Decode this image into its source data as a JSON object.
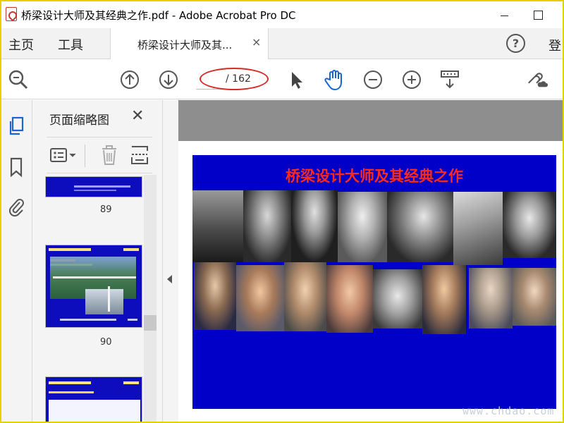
{
  "window": {
    "title": "桥梁设计大师及其经典之作.pdf - Adobe Acrobat Pro DC"
  },
  "tabs": {
    "home": "主页",
    "tools": "工具",
    "document": "桥梁设计大师及其...",
    "close": "×",
    "help": "?",
    "login": "登"
  },
  "toolbar": {
    "current_page": "",
    "page_total": "/ 162"
  },
  "thumbnails": {
    "title": "页面缩略图",
    "close": "✕",
    "pages": [
      {
        "label": "89"
      },
      {
        "label": "90"
      }
    ]
  },
  "page": {
    "title": "桥梁设计大师及其经典之作"
  },
  "watermark": "www.chdao.com",
  "colors": {
    "page_bg": "#0000c8",
    "page_title": "#ff2a1a",
    "annotation": "#d72a24",
    "accent_hand": "#1a66d0"
  },
  "icons": [
    "search-icon",
    "page-up-icon",
    "page-down-icon",
    "select-arrow-icon",
    "hand-icon",
    "zoom-out-icon",
    "zoom-in-icon",
    "scroll-mode-icon",
    "link-cloud-icon",
    "pages-icon",
    "bookmark-icon",
    "attachment-icon",
    "thumbnail-options-icon",
    "delete-icon",
    "extract-icon"
  ]
}
